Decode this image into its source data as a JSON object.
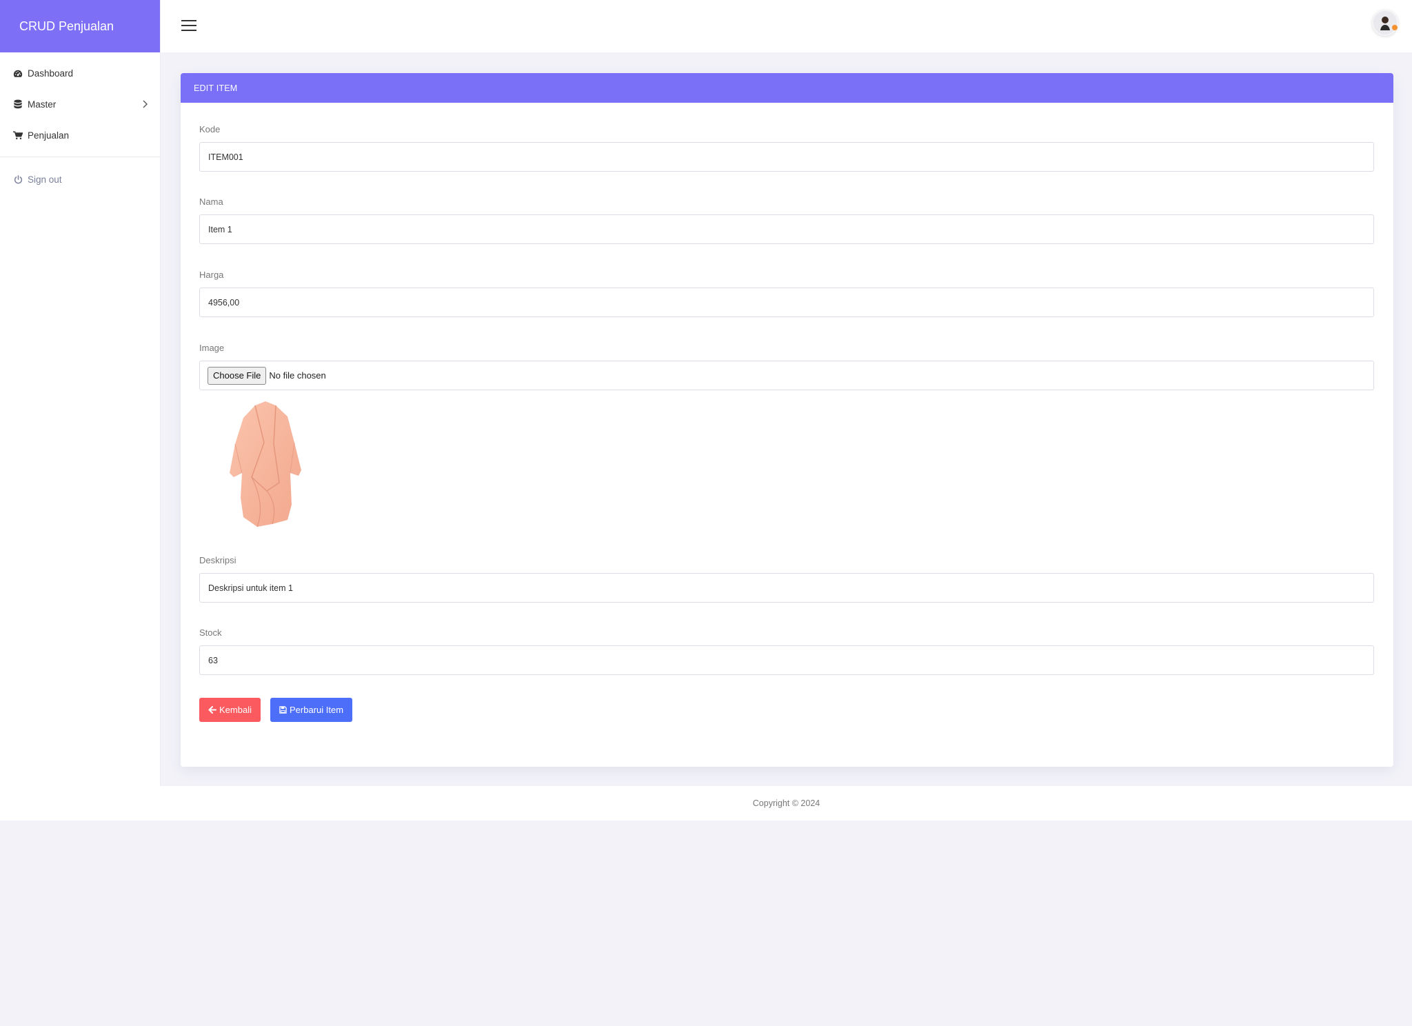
{
  "brand": "CRUD Penjualan",
  "sidebar": {
    "items": [
      {
        "label": "Dashboard",
        "icon": "dashboard-icon"
      },
      {
        "label": "Master",
        "icon": "database-icon"
      },
      {
        "label": "Penjualan",
        "icon": "cart-icon"
      }
    ],
    "signout": "Sign out"
  },
  "card": {
    "title": "EDIT ITEM"
  },
  "form": {
    "kode": {
      "label": "Kode",
      "value": "ITEM001"
    },
    "nama": {
      "label": "Nama",
      "value": "Item 1"
    },
    "harga": {
      "label": "Harga",
      "value": "4956,00"
    },
    "image": {
      "label": "Image",
      "button": "Choose File",
      "status": "No file chosen"
    },
    "deskripsi": {
      "label": "Deskripsi",
      "value": "Deskripsi untuk item 1"
    },
    "stock": {
      "label": "Stock",
      "value": "63"
    }
  },
  "buttons": {
    "back": "Kembali",
    "save": "Perbarui Item"
  },
  "footer": "Copyright © 2024",
  "colors": {
    "brand": "#7e6ff7",
    "back_button": "#fb5a5f",
    "save_button": "#4c6ef9"
  }
}
